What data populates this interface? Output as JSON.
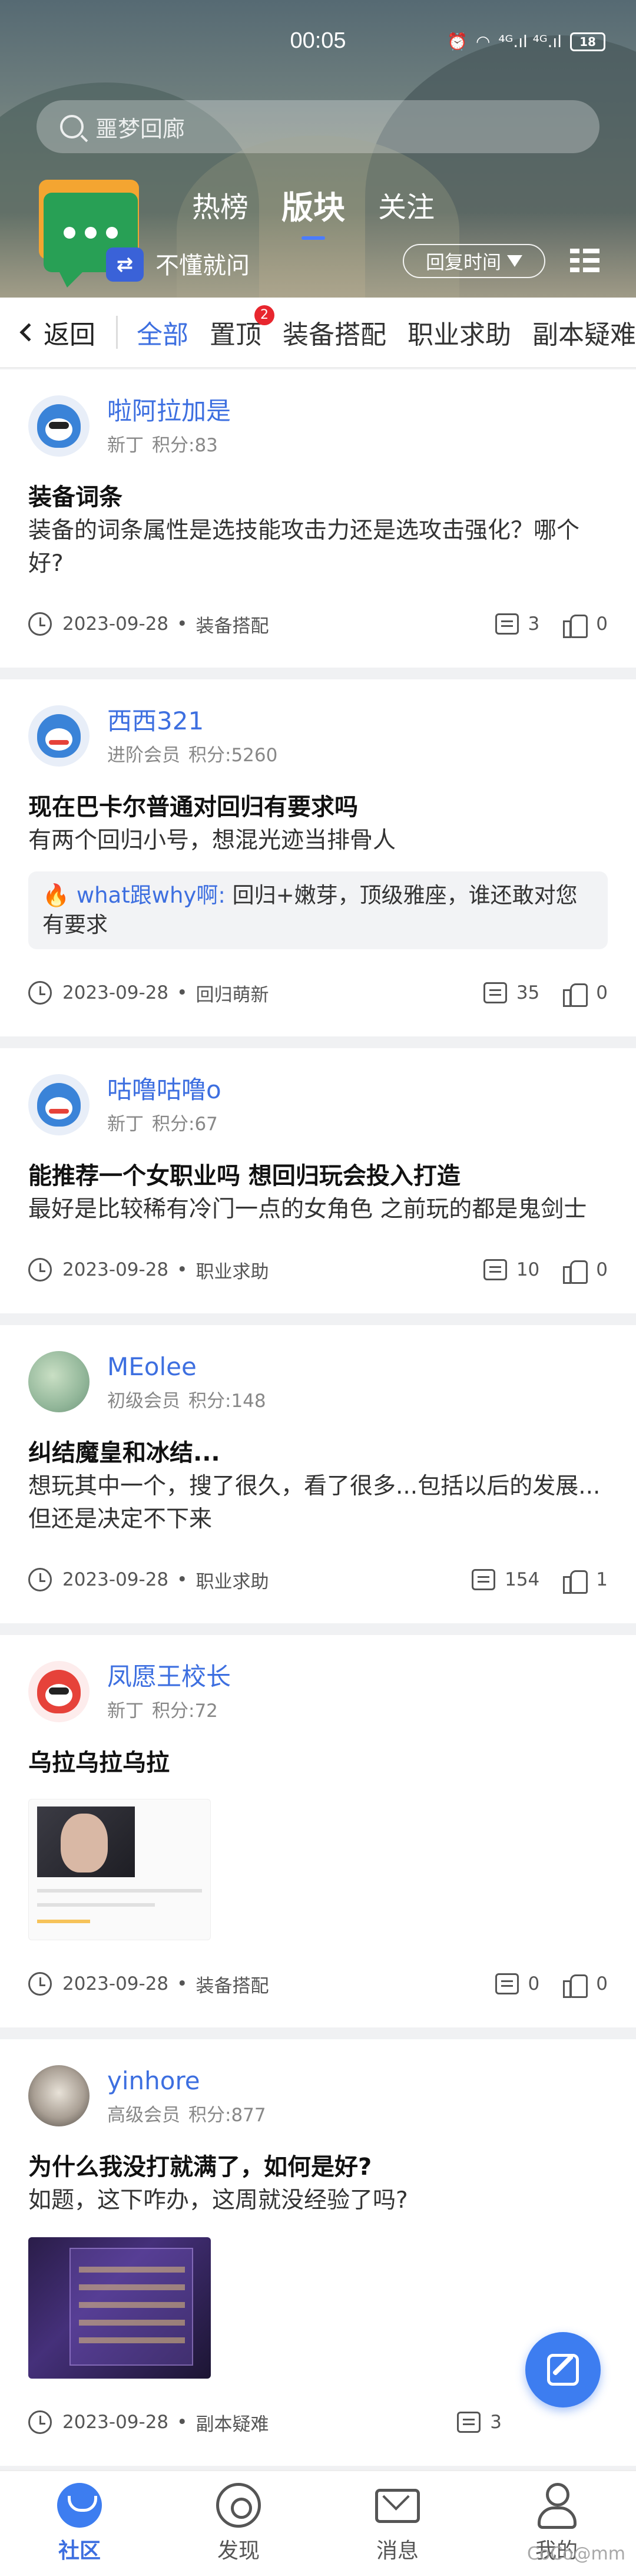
{
  "status_bar": {
    "time": "00:05",
    "signal": "⁴ᴳ.ıl ⁴ᴳ.ıl",
    "battery": "18"
  },
  "search": {
    "placeholder": "噩梦回廊"
  },
  "board": {
    "name": "不懂就问"
  },
  "top_tabs": [
    {
      "label": "热榜",
      "active": false
    },
    {
      "label": "版块",
      "active": true
    },
    {
      "label": "关注",
      "active": false
    }
  ],
  "sort": {
    "label": "回复时间"
  },
  "category_bar": {
    "back_label": "返回",
    "categories": [
      "全部",
      "置顶",
      "装备搭配",
      "职业求助",
      "副本疑难"
    ],
    "pinned_badge": "2"
  },
  "posts": [
    {
      "author": "啦阿拉加是",
      "level": "新丁",
      "points": "积分:83",
      "title": "装备词条",
      "body": "装备的词条属性是选技能攻击力还是选攻击强化？哪个好?",
      "date": "2023-09-28",
      "category": "装备搭配",
      "comments": "3",
      "likes": "0"
    },
    {
      "author": "西西321",
      "level": "进阶会员",
      "points": "积分:5260",
      "title": "现在巴卡尔普通对回归有要求吗",
      "body": "有两个回归小号，想混光迹当排骨人",
      "reply_user": "what跟why啊:",
      "reply_text": " 回归+嫩芽，顶级雅座，谁还敢对您有要求",
      "date": "2023-09-28",
      "category": "回归萌新",
      "comments": "35",
      "likes": "0"
    },
    {
      "author": "咕噜咕噜o",
      "level": "新丁",
      "points": "积分:67",
      "title": "能推荐一个女职业吗 想回归玩会投入打造",
      "body": "最好是比较稀有冷门一点的女角色 之前玩的都是鬼剑士",
      "date": "2023-09-28",
      "category": "职业求助",
      "comments": "10",
      "likes": "0"
    },
    {
      "author": "MEolee",
      "level": "初级会员",
      "points": "积分:148",
      "title": "纠结魔皇和冰结...",
      "body": "想玩其中一个，搜了很久，看了很多...包括以后的发展...但还是决定不下来",
      "date": "2023-09-28",
      "category": "职业求助",
      "comments": "154",
      "likes": "1"
    },
    {
      "author": "凤愿王校长",
      "level": "新丁",
      "points": "积分:72",
      "title": "乌拉乌拉乌拉",
      "date": "2023-09-28",
      "category": "装备搭配",
      "comments": "0",
      "likes": "0"
    },
    {
      "author": "yinhore",
      "level": "高级会员",
      "points": "积分:877",
      "title": "为什么我没打就满了，如何是好?",
      "body": "如题，这下咋办，这周就没经验了吗?",
      "date": "2023-09-28",
      "category": "副本疑难",
      "comments": "3",
      "likes": ""
    }
  ],
  "bottom_nav": [
    {
      "label": "社区",
      "icon": "community-icon",
      "active": true
    },
    {
      "label": "发现",
      "icon": "discover-icon",
      "active": false
    },
    {
      "label": "消息",
      "icon": "message-icon",
      "active": false
    },
    {
      "label": "我的",
      "icon": "profile-icon",
      "active": false
    }
  ],
  "watermark": "CoCo@mm",
  "colors": {
    "accent": "#3d6fe0",
    "badge": "#e8262e",
    "fab": "#3d7df0"
  }
}
